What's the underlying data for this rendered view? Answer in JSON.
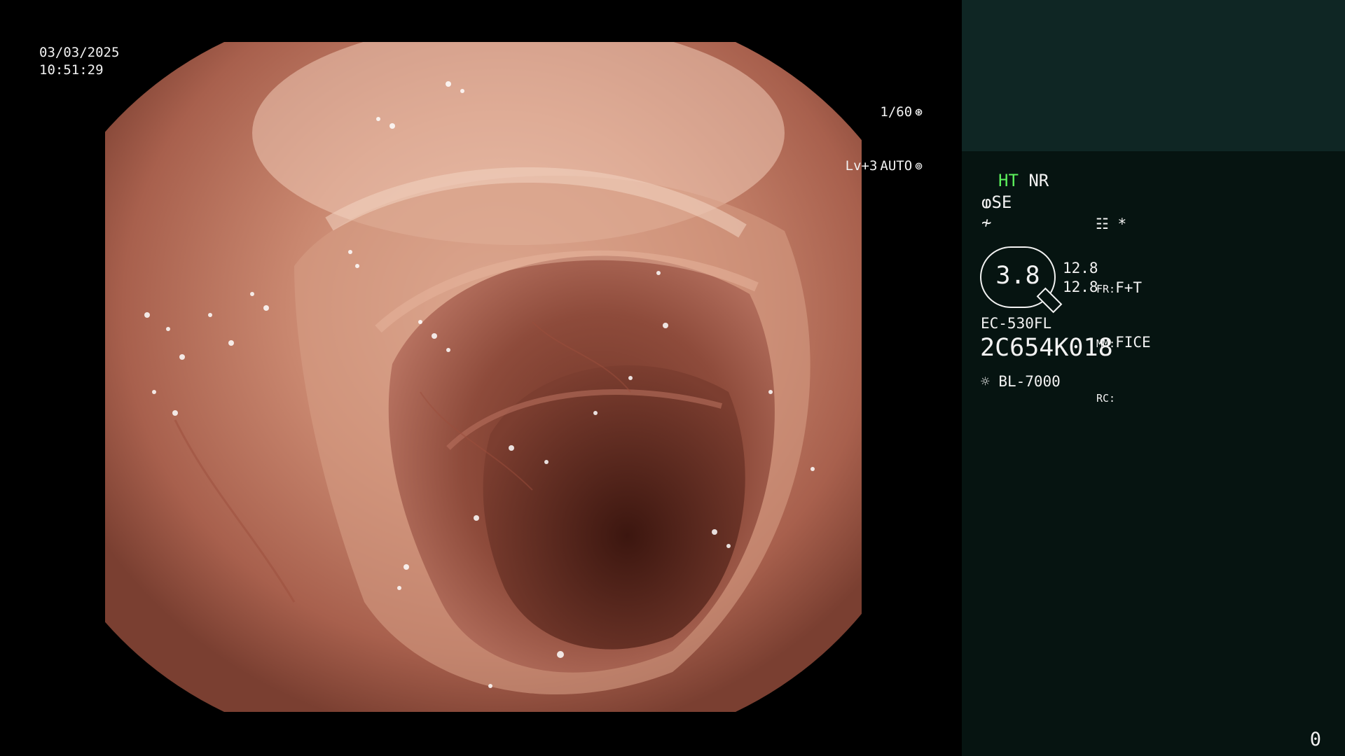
{
  "overlay": {
    "date": "03/03/2025",
    "time": "10:51:29",
    "shutter": "1/60",
    "shutter_icon": "aperture-icon",
    "level": "Lv+3",
    "exposure_mode": "AUTO",
    "exposure_icon": "iris-icon"
  },
  "panel": {
    "ht": "HT",
    "nr": "NR",
    "se_icon": "enhancement-icon",
    "se": "SE",
    "gamma_icon": "curve-icon",
    "menu_icon": "settings-panel-icon",
    "star": "*",
    "magnification": "3.8",
    "value_1": "12.8",
    "value_2": "12.8",
    "fr_label": "FR:",
    "fr_value": "F+T",
    "mm_label": "MM:",
    "mm_value": "FICE",
    "rc_label": "RC:",
    "scope_model": "EC-530FL",
    "scope_serial": "2C654K018",
    "light_icon": "sun-icon",
    "light_source": "BL-7000",
    "page_number": "0"
  },
  "colors": {
    "accent_green": "#5cf05c",
    "panel_bg": "#061411",
    "panel_top_bg": "#0f2624",
    "tissue": "#c98a73"
  }
}
